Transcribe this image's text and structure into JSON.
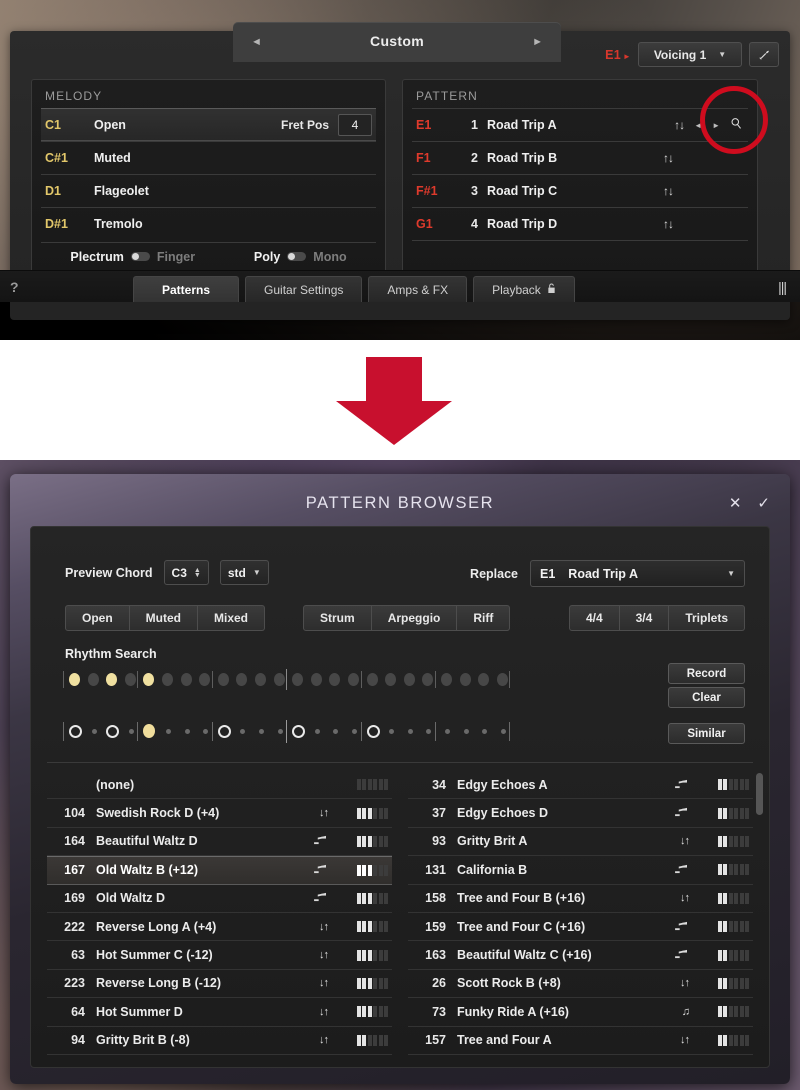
{
  "top": {
    "header_tab": {
      "title": "Custom",
      "prev_icon": "◄",
      "next_icon": "►"
    },
    "toolbar": {
      "slot": "E1",
      "slot_caret": "►",
      "voicing": "Voicing 1",
      "voicing_caret": "▼",
      "wrench_icon": "🔧"
    },
    "melody": {
      "title": "MELODY",
      "fret_label": "Fret Pos",
      "fret_value": "4",
      "rows": [
        {
          "note": "C1",
          "name": "Open",
          "selected": true
        },
        {
          "note": "C#1",
          "name": "Muted",
          "selected": false
        },
        {
          "note": "D1",
          "name": "Flageolet",
          "selected": false
        },
        {
          "note": "D#1",
          "name": "Tremolo",
          "selected": false
        }
      ],
      "toggles": [
        {
          "left": "Plectrum",
          "right": "Finger"
        },
        {
          "left": "Poly",
          "right": "Mono"
        }
      ]
    },
    "pattern": {
      "title": "PATTERN",
      "rows": [
        {
          "note": "E1",
          "index": "1",
          "name": "Road Trip A",
          "has_nav": true
        },
        {
          "note": "F1",
          "index": "2",
          "name": "Road Trip B",
          "has_nav": false
        },
        {
          "note": "F#1",
          "index": "3",
          "name": "Road Trip C",
          "has_nav": false
        },
        {
          "note": "G1",
          "index": "4",
          "name": "Road Trip D",
          "has_nav": false
        }
      ],
      "sort_icon": "↑↓",
      "prev_icon": "◄",
      "next_icon": "►",
      "search_icon": "⌕"
    },
    "tabs": [
      {
        "label": "Patterns",
        "active": true,
        "lock": false
      },
      {
        "label": "Guitar Settings",
        "active": false,
        "lock": false
      },
      {
        "label": "Amps & FX",
        "active": false,
        "lock": false
      },
      {
        "label": "Playback",
        "active": false,
        "lock": true
      }
    ],
    "help_icon": "?",
    "meter_icon": "|||"
  },
  "annotation": {
    "circle": "red-highlight-circle",
    "arrow": "red-down-arrow"
  },
  "browser": {
    "title": "PATTERN BROWSER",
    "close_icon": "✕",
    "confirm_icon": "✓",
    "preview_chord": {
      "label": "Preview Chord",
      "note": "C3",
      "stepper_up": "▲",
      "stepper_down": "▼",
      "type": "std",
      "type_caret": "▼"
    },
    "replace": {
      "label": "Replace",
      "slot": "E1",
      "name": "Road Trip A",
      "caret": "▼"
    },
    "filters": [
      [
        "Open",
        "Muted",
        "Mixed"
      ],
      [
        "Strum",
        "Arpeggio",
        "Riff"
      ],
      [
        "4/4",
        "3/4",
        "Triplets"
      ]
    ],
    "rhythm_search": {
      "label": "Rhythm Search",
      "record_label": "Record",
      "clear_label": "Clear",
      "similar_label": "Similar",
      "steps": 24,
      "active_steps": [
        0,
        2,
        4
      ],
      "result_rings": [
        0,
        2,
        8,
        12,
        16
      ],
      "result_filled": [
        4
      ]
    },
    "list_left": [
      {
        "num": "",
        "name": "(none)",
        "icon": "",
        "rating": 0,
        "selected": false
      },
      {
        "num": "104",
        "name": "Swedish Rock D (+4)",
        "icon": "↓↑",
        "rating": 3,
        "selected": false
      },
      {
        "num": "164",
        "name": "Beautiful Waltz D",
        "icon": "swing",
        "rating": 3,
        "selected": false
      },
      {
        "num": "167",
        "name": "Old Waltz B (+12)",
        "icon": "swing",
        "rating": 3,
        "selected": true
      },
      {
        "num": "169",
        "name": "Old Waltz D",
        "icon": "swing",
        "rating": 3,
        "selected": false
      },
      {
        "num": "222",
        "name": "Reverse Long A (+4)",
        "icon": "↓↑",
        "rating": 3,
        "selected": false
      },
      {
        "num": "63",
        "name": "Hot Summer C (-12)",
        "icon": "↓↑",
        "rating": 3,
        "selected": false
      },
      {
        "num": "223",
        "name": "Reverse Long B (-12)",
        "icon": "↓↑",
        "rating": 3,
        "selected": false
      },
      {
        "num": "64",
        "name": "Hot Summer D",
        "icon": "↓↑",
        "rating": 3,
        "selected": false
      },
      {
        "num": "94",
        "name": "Gritty Brit B (-8)",
        "icon": "↓↑",
        "rating": 2,
        "selected": false
      }
    ],
    "list_right": [
      {
        "num": "34",
        "name": "Edgy Echoes A",
        "icon": "swing",
        "rating": 2,
        "selected": false
      },
      {
        "num": "37",
        "name": "Edgy Echoes D",
        "icon": "swing",
        "rating": 2,
        "selected": false
      },
      {
        "num": "93",
        "name": "Gritty Brit A",
        "icon": "↓↑",
        "rating": 2,
        "selected": false
      },
      {
        "num": "131",
        "name": "California B",
        "icon": "swing",
        "rating": 2,
        "selected": false
      },
      {
        "num": "158",
        "name": "Tree and Four B (+16)",
        "icon": "↓↑",
        "rating": 2,
        "selected": false
      },
      {
        "num": "159",
        "name": "Tree and Four C (+16)",
        "icon": "swing",
        "rating": 2,
        "selected": false
      },
      {
        "num": "163",
        "name": "Beautiful Waltz C (+16)",
        "icon": "swing",
        "rating": 2,
        "selected": false
      },
      {
        "num": "26",
        "name": "Scott Rock B (+8)",
        "icon": "↓↑",
        "rating": 2,
        "selected": false
      },
      {
        "num": "73",
        "name": "Funky Ride A (+16)",
        "icon": "♫",
        "rating": 2,
        "selected": false
      },
      {
        "num": "157",
        "name": "Tree and Four A",
        "icon": "↓↑",
        "rating": 2,
        "selected": false
      }
    ]
  },
  "colors": {
    "accent_red": "#df3a2c",
    "annotation_red": "#c8102e",
    "melody_yellow": "#e2c76a",
    "step_on": "#f0e0a0"
  }
}
